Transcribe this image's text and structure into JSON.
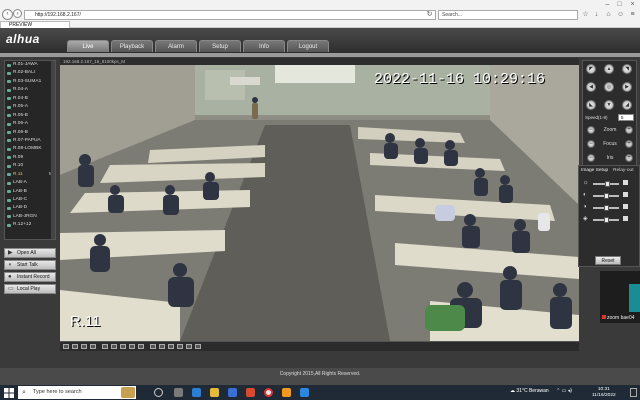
{
  "browser": {
    "url": "http://192.168.2.167/",
    "search_placeholder": "Search...",
    "tab_title": "PREVIEW"
  },
  "app": {
    "logo": "alhua",
    "nav": [
      "Live",
      "Playback",
      "Alarm",
      "Setup",
      "Info",
      "Logout"
    ],
    "active_nav": "Live",
    "channels": [
      "R.01-JAWA",
      "R.02-BALI",
      "R.03-SUMA1",
      "R.04-A",
      "R.04-B",
      "R.05-A",
      "R.05-B",
      "R.06-A",
      "R.06-B",
      "R.07-PAPUA",
      "R.08-LOMBK",
      "R.09",
      "R.10",
      "R.11",
      "LAB-A",
      "LAB-B",
      "LAB-C",
      "LAB-D",
      "LAB-JRGN",
      "R.12+12"
    ],
    "selected_channel": "R.11",
    "selected_channel_marker": "M",
    "left_buttons": [
      {
        "label": "Open All",
        "icon": "play-icon"
      },
      {
        "label": "Start Talk",
        "icon": "speaker-icon"
      },
      {
        "label": "Instant Record",
        "icon": "record-icon"
      },
      {
        "label": "Local Play",
        "icon": "folder-icon"
      }
    ],
    "video": {
      "header": "192.168.2.167_16_9100kps_M",
      "osd_time": "2022-11-16 10:29:16",
      "osd_channel": "R.11"
    },
    "ptz": {
      "speed_label": "Speed(1-8)",
      "speed_value": "5",
      "zoom": "Zoom",
      "focus": "Focus",
      "iris": "Iris"
    },
    "image_setup": {
      "title": "Image Setup",
      "relay": "Relay-out",
      "reset": "Reset",
      "levels": [
        0.55,
        0.5,
        0.5,
        0.5
      ]
    },
    "copyright": "Copyright 2015,All Rights Reserved.",
    "zoom_label": "zoom bae04"
  },
  "taskbar": {
    "search_placeholder": "Type here to search",
    "weather": "31°C Berawan",
    "time": "10:31",
    "date": "11/16/2022"
  }
}
